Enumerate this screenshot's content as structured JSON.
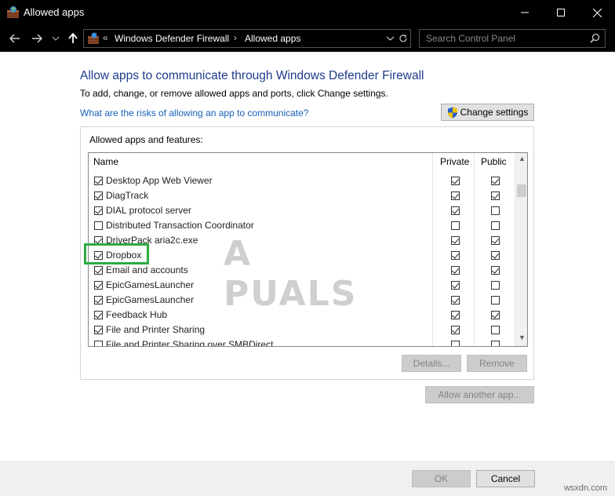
{
  "window": {
    "title": "Allowed apps"
  },
  "address": {
    "crumbs": [
      "Windows Defender Firewall",
      "Allowed apps"
    ]
  },
  "search": {
    "placeholder": "Search Control Panel"
  },
  "content": {
    "heading": "Allow apps to communicate through Windows Defender Firewall",
    "subtext": "To add, change, or remove allowed apps and ports, click Change settings.",
    "risk_link": "What are the risks of allowing an app to communicate?",
    "change_settings": "Change settings",
    "group_label": "Allowed apps and features:",
    "columns": {
      "name": "Name",
      "private": "Private",
      "public": "Public"
    },
    "apps": [
      {
        "name": "Desktop App Web Viewer",
        "enabled": true,
        "private": true,
        "public": true
      },
      {
        "name": "DiagTrack",
        "enabled": true,
        "private": true,
        "public": true
      },
      {
        "name": "DIAL protocol server",
        "enabled": true,
        "private": true,
        "public": false
      },
      {
        "name": "Distributed Transaction Coordinator",
        "enabled": false,
        "private": false,
        "public": false
      },
      {
        "name": "DriverPack aria2c.exe",
        "enabled": true,
        "private": true,
        "public": true
      },
      {
        "name": "Dropbox",
        "enabled": true,
        "private": true,
        "public": true
      },
      {
        "name": "Email and accounts",
        "enabled": true,
        "private": true,
        "public": true
      },
      {
        "name": "EpicGamesLauncher",
        "enabled": true,
        "private": true,
        "public": false
      },
      {
        "name": "EpicGamesLauncher",
        "enabled": true,
        "private": true,
        "public": false
      },
      {
        "name": "Feedback Hub",
        "enabled": true,
        "private": true,
        "public": true
      },
      {
        "name": "File and Printer Sharing",
        "enabled": true,
        "private": true,
        "public": false
      },
      {
        "name": "File and Printer Sharing over SMBDirect",
        "enabled": false,
        "private": false,
        "public": false
      }
    ],
    "details_button": "Details...",
    "remove_button": "Remove",
    "allow_another_button": "Allow another app..."
  },
  "footer": {
    "ok": "OK",
    "cancel": "Cancel"
  },
  "watermark": "A PUALS",
  "site_mark": "wsxdn.com",
  "colors": {
    "heading": "#1e3c8c",
    "link": "#1660b9",
    "highlight": "#2eab3f"
  },
  "icons": [
    "firewall-app-icon",
    "minimize-icon",
    "maximize-icon",
    "close-icon",
    "back-arrow-icon",
    "forward-arrow-icon",
    "recent-chevron-icon",
    "up-arrow-icon",
    "dropdown-chevron-icon",
    "refresh-icon",
    "search-icon",
    "uac-shield-icon"
  ]
}
